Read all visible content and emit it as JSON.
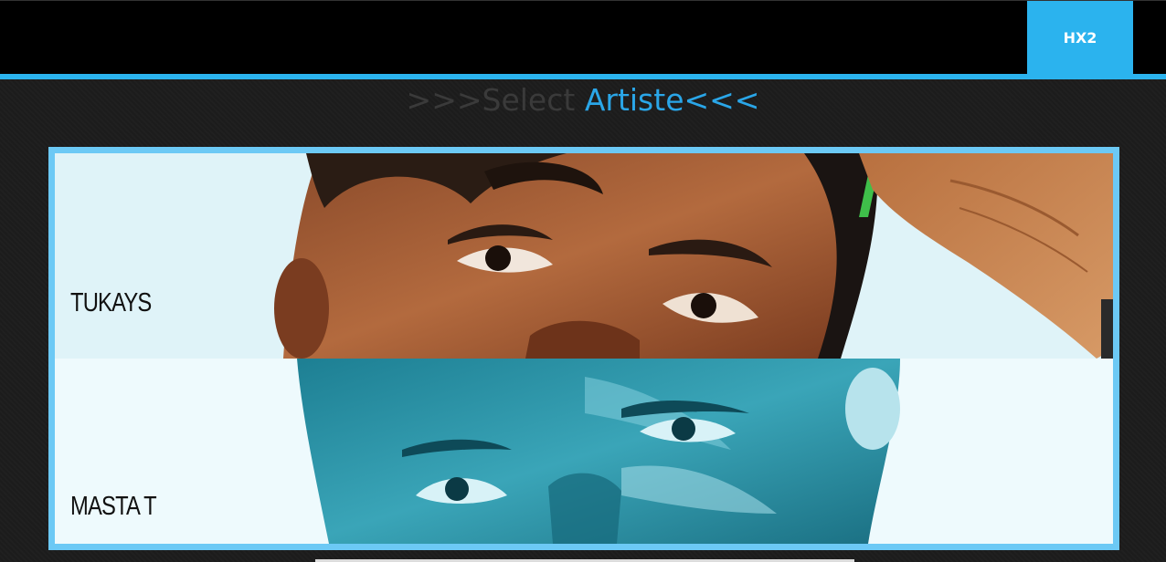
{
  "header": {
    "tab_label": "HX2"
  },
  "heading": {
    "prefix": ">>>",
    "select": "Select",
    "artiste": "Artiste",
    "suffix": "<<<"
  },
  "artists": [
    {
      "name": "TUKAYS"
    },
    {
      "name": "MASTA T"
    }
  ],
  "colors": {
    "accent": "#2bb3ee",
    "panel_border": "#6cc9f5",
    "topbar": "#000000",
    "background": "#1c1c1c"
  }
}
